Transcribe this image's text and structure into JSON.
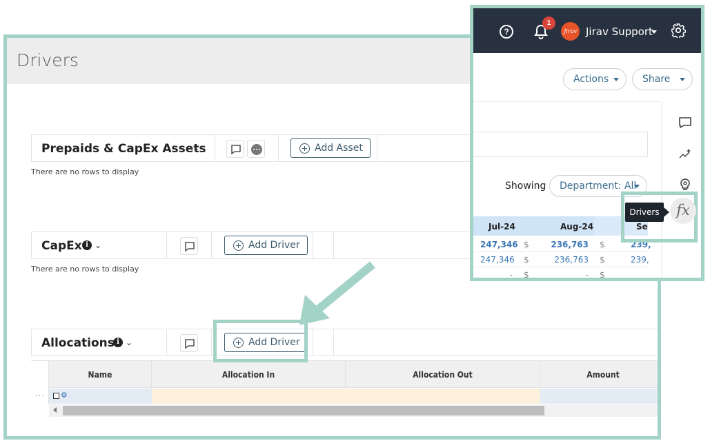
{
  "page": {
    "title": "Drivers"
  },
  "sections": {
    "prepaids": {
      "title": "Prepaids & CapEx Assets",
      "add_label": "Add Asset",
      "empty": "There are no rows to display"
    },
    "capex": {
      "title": "CapEx",
      "add_label": "Add Driver",
      "empty": "There are no rows to display"
    },
    "allocations": {
      "title": "Allocations",
      "add_label": "Add Driver"
    }
  },
  "allocation_grid": {
    "columns": [
      "Name",
      "Allocation In",
      "Allocation Out",
      "Amount"
    ],
    "row_menu": "···"
  },
  "topbar": {
    "notification_count": "1",
    "avatar_text": "Jirav",
    "user_name": "Jirav Support"
  },
  "toolbar": {
    "actions_label": "Actions",
    "share_label": "Share"
  },
  "filter": {
    "showing_label": "Showing",
    "department_label": "Department: All"
  },
  "mini_table": {
    "headers": [
      "Jul-24",
      "Aug-24",
      "Se"
    ],
    "rows": [
      {
        "jul": "247,346",
        "aug_sym": "$",
        "aug": "236,763",
        "sep_sym": "$",
        "sep": "239,"
      },
      {
        "jul": "247,346",
        "aug_sym": "$",
        "aug": "236,763",
        "sep_sym": "$",
        "sep": "239,"
      },
      {
        "jul": "-",
        "aug_sym": "$",
        "aug": "-",
        "sep_sym": "$",
        "sep": ""
      }
    ]
  },
  "tooltip": {
    "drivers": "Drivers"
  },
  "side_rail": {
    "fx_label": "fx"
  },
  "colors": {
    "highlight": "#a3d2c7",
    "topbar": "#283140",
    "accent": "#3c6f8e",
    "badge": "#d9453a"
  }
}
